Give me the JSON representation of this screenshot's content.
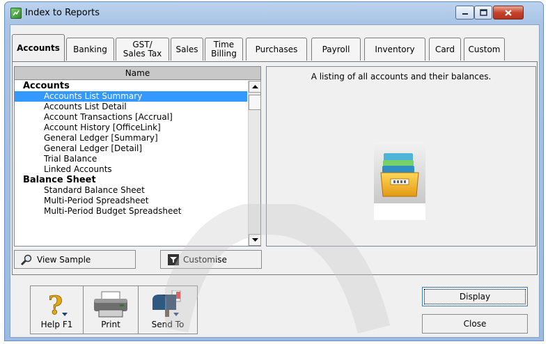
{
  "window": {
    "title": "Index to Reports"
  },
  "tabs": [
    {
      "label": "Accounts",
      "active": true
    },
    {
      "label": "Banking"
    },
    {
      "label": "GST/\nSales Tax"
    },
    {
      "label": "Sales"
    },
    {
      "label": "Time\nBilling"
    },
    {
      "label": "Purchases"
    },
    {
      "label": "Payroll"
    },
    {
      "label": "Inventory"
    },
    {
      "label": "Card"
    },
    {
      "label": "Custom"
    }
  ],
  "report_list": {
    "header": "Name",
    "items": [
      {
        "label": "Accounts",
        "type": "group"
      },
      {
        "label": "Accounts List Summary",
        "type": "report",
        "selected": true
      },
      {
        "label": "Accounts List Detail",
        "type": "report"
      },
      {
        "label": "Account Transactions [Accrual]",
        "type": "report"
      },
      {
        "label": "Account History [OfficeLink]",
        "type": "report"
      },
      {
        "label": "General Ledger [Summary]",
        "type": "report"
      },
      {
        "label": "General Ledger [Detail]",
        "type": "report"
      },
      {
        "label": "Trial Balance",
        "type": "report"
      },
      {
        "label": "Linked Accounts",
        "type": "report"
      },
      {
        "label": "Balance Sheet",
        "type": "group"
      },
      {
        "label": "Standard Balance Sheet",
        "type": "report"
      },
      {
        "label": "Multi-Period Spreadsheet",
        "type": "report"
      },
      {
        "label": "Multi-Period Budget Spreadsheet",
        "type": "report"
      }
    ]
  },
  "description": {
    "text": "A listing of all accounts and their balances.",
    "icon": "file-folder-icon"
  },
  "buttons": {
    "view_sample": "View Sample",
    "customise": "Customise",
    "display": "Display",
    "close": "Close"
  },
  "toolbar": {
    "help": "Help F1",
    "print": "Print",
    "send_to": "Send To"
  },
  "colors": {
    "selection": "#3399ff",
    "title_bar": "#a8c4e6",
    "close_button": "#c7432c"
  }
}
